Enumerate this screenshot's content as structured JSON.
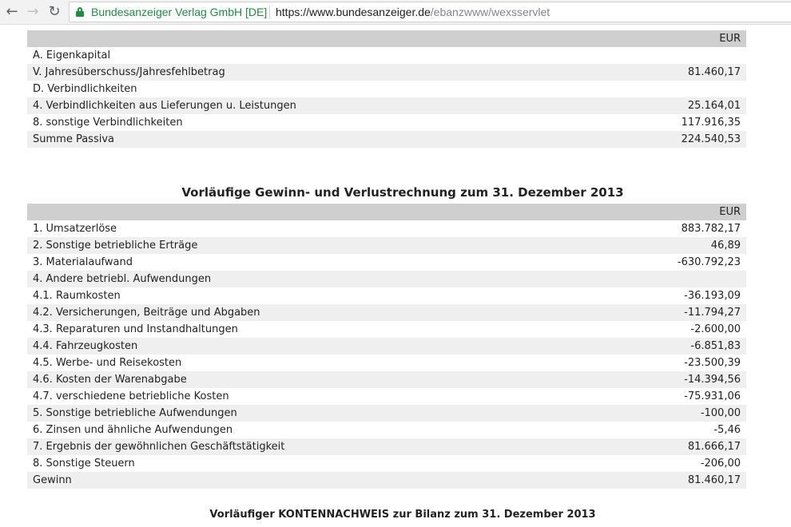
{
  "browser": {
    "back_icon": "back-arrow-icon",
    "forward_icon": "forward-arrow-icon",
    "reload_icon": "reload-icon",
    "lock_icon": "lock-icon",
    "site_name": "Bundesanzeiger Verlag GmbH [DE]",
    "url_host": "https://www.bundesanzeiger.de",
    "url_path": "/ebanzwww/wexsservlet"
  },
  "passiva": {
    "currency": "EUR",
    "rows": [
      {
        "label": "A. Eigenkapital",
        "amount": ""
      },
      {
        "label": "V. Jahresüberschuss/Jahresfehlbetrag",
        "amount": "81.460,17"
      },
      {
        "label": "D. Verbindlichkeiten",
        "amount": ""
      },
      {
        "label": "4. Verbindlichkeiten aus Lieferungen u. Leistungen",
        "amount": "25.164,01"
      },
      {
        "label": "8. sonstige Verbindlichkeiten",
        "amount": "117.916,35"
      },
      {
        "label": "Summe Passiva",
        "amount": "224.540,53"
      }
    ]
  },
  "guv": {
    "title": "Vorläufige Gewinn- und Verlustrechnung zum 31. Dezember 2013",
    "currency": "EUR",
    "rows": [
      {
        "label": "1. Umsatzerlöse",
        "amount": "883.782,17"
      },
      {
        "label": "2. Sonstige betriebliche Erträge",
        "amount": "46,89"
      },
      {
        "label": "3. Materialaufwand",
        "amount": "-630.792,23"
      },
      {
        "label": "4. Andere betriebl. Aufwendungen",
        "amount": ""
      },
      {
        "label": "4.1. Raumkosten",
        "amount": "-36.193,09"
      },
      {
        "label": "4.2. Versicherungen, Beiträge und Abgaben",
        "amount": "-11.794,27"
      },
      {
        "label": "4.3. Reparaturen und Instandhaltungen",
        "amount": "-2.600,00"
      },
      {
        "label": "4.4. Fahrzeugkosten",
        "amount": "-6.851,83"
      },
      {
        "label": "4.5. Werbe- und Reisekosten",
        "amount": "-23.500,39"
      },
      {
        "label": "4.6. Kosten der Warenabgabe",
        "amount": "-14.394,56"
      },
      {
        "label": "4.7. verschiedene betriebliche Kosten",
        "amount": "-75.931,06"
      },
      {
        "label": "5. Sonstige betriebliche Aufwendungen",
        "amount": "-100,00"
      },
      {
        "label": "6. Zinsen und ähnliche Aufwendungen",
        "amount": "-5,46"
      },
      {
        "label": "7. Ergebnis der gewöhnlichen Geschäftstätigkeit",
        "amount": "81.666,17"
      },
      {
        "label": "8. Sonstige Steuern",
        "amount": "-206,00"
      },
      {
        "label": "Gewinn",
        "amount": "81.460,17"
      }
    ]
  },
  "kontennachweis": {
    "title": "Vorläufiger KONTENNACHWEIS zur Bilanz zum 31. Dezember 2013"
  }
}
